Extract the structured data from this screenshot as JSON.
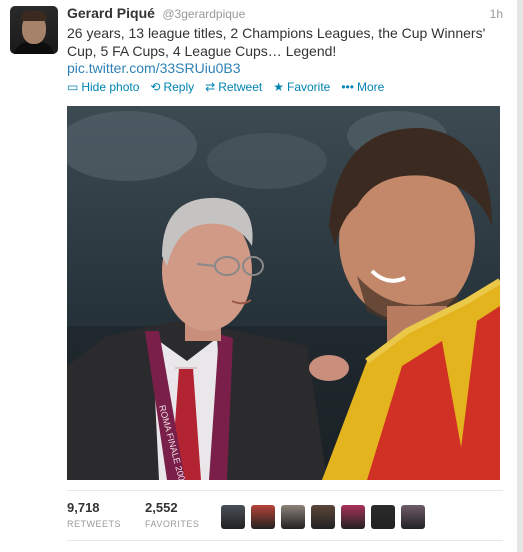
{
  "tweet": {
    "fullname": "Gerard Piqué",
    "username": "@3gerardpique",
    "time": "1h",
    "text": "26 years, 13 league titles, 2 Champions Leagues, the Cup Winners' Cup, 5 FA Cups, 4 League Cups… Legend!",
    "link": "pic.twitter.com/33SRUiu0B3"
  },
  "actions": [
    {
      "label": "Hide photo",
      "icon": "photo-icon",
      "glyph": "▭"
    },
    {
      "label": "Reply",
      "icon": "reply-icon",
      "glyph": "⟲"
    },
    {
      "label": "Retweet",
      "icon": "retweet-icon",
      "glyph": "⇄"
    },
    {
      "label": "Favorite",
      "icon": "star-icon",
      "glyph": "★"
    },
    {
      "label": "More",
      "icon": "more-icon",
      "glyph": "•••"
    }
  ],
  "photo": {
    "medal_ribbon_text": "ROMA FINALE 2009"
  },
  "stats": {
    "retweets_count": "9,718",
    "retweets_label": "RETWEETS",
    "favorites_count": "2,552",
    "favorites_label": "FAVORITES"
  },
  "favoriters": [
    {
      "name": "faver-avatar-1",
      "color": "#4a4f57"
    },
    {
      "name": "faver-avatar-2",
      "color": "#b5443a"
    },
    {
      "name": "faver-avatar-3",
      "color": "#8c8279"
    },
    {
      "name": "faver-avatar-4",
      "color": "#5b4638"
    },
    {
      "name": "faver-avatar-5",
      "color": "#a8325a"
    },
    {
      "name": "faver-avatar-6",
      "color": "#2b2b2b"
    },
    {
      "name": "faver-avatar-7",
      "color": "#6e5b6a"
    }
  ],
  "colors": {
    "link": "#2f82b6",
    "action": "#0084b4",
    "muted": "#999999",
    "text": "#333333"
  }
}
